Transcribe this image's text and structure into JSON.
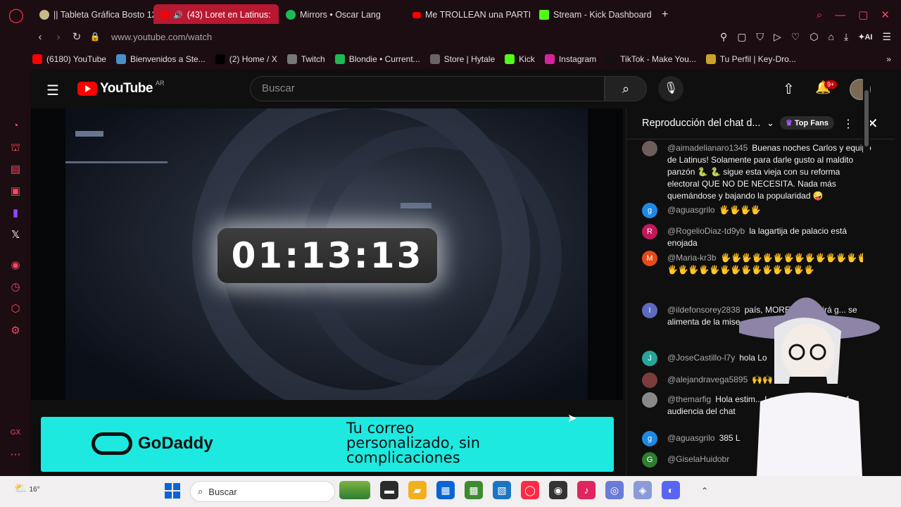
{
  "tabs": [
    {
      "label": "|| Tableta Gráfica Bosto 12",
      "icon": "bosto-icon",
      "active": false
    },
    {
      "label": "(43) Loret en Latinus:",
      "icon": "youtube-icon",
      "active": true
    },
    {
      "label": "Mirrors • Oscar Lang",
      "icon": "spotify-icon",
      "active": false
    },
    {
      "label": "Me TROLLEAN una PARTI",
      "icon": "youtube-icon",
      "active": false
    },
    {
      "label": "Stream - Kick Dashboard",
      "icon": "kick-icon",
      "active": false
    }
  ],
  "address": {
    "url": "www.youtube.com/watch",
    "ai_label": "AI"
  },
  "bookmarks": [
    {
      "label": "(6180) YouTube",
      "icon": "youtube-icon",
      "color": "#ff0000"
    },
    {
      "label": "Bienvenidos a Ste...",
      "icon": "steam-icon",
      "color": "#4a90c8"
    },
    {
      "label": "(2) Home / X",
      "icon": "x-icon",
      "color": "#000000"
    },
    {
      "label": "Twitch",
      "icon": "page-icon",
      "color": "#777777"
    },
    {
      "label": "Blondie • Current...",
      "icon": "spotify-icon",
      "color": "#1db954"
    },
    {
      "label": "Store | Hytale",
      "icon": "hytale-icon",
      "color": "#666666"
    },
    {
      "label": "Kick",
      "icon": "kick-icon",
      "color": "#53fc18"
    },
    {
      "label": "Instagram",
      "icon": "instagram-icon",
      "color": "#d6249f"
    },
    {
      "label": "TikTok - Make You...",
      "icon": "tiktok-icon",
      "color": "#111111"
    },
    {
      "label": "Tu Perfil | Key-Dro...",
      "icon": "keydrop-icon",
      "color": "#c9a227"
    }
  ],
  "youtube": {
    "logo_text": "YouTube",
    "region": "AR",
    "search_placeholder": "Buscar",
    "notification_count": "9+"
  },
  "player": {
    "countdown": "01:13:13"
  },
  "ad": {
    "brand": "GoDaddy",
    "text_lines": [
      "Tu correo",
      "personalizado, sin",
      "complicaciones"
    ]
  },
  "chat": {
    "title": "Reproducción del chat d...",
    "filter": "Top Fans",
    "messages": [
      {
        "initial": "",
        "avatar_color": "#6d5d5d",
        "user": "@aimadelianaro1345",
        "text": "Buenas noches Carlos y equipo de Latinus! Solamente para darle gusto al maldito panzón 🐍 🐍 sigue esta vieja con su reforma electoral QUE NO DE NECESITA. Nada más quemándose y bajando la popularidad 🤪"
      },
      {
        "initial": "g",
        "avatar_color": "#1e88e5",
        "user": "@aguasgrilo",
        "text": "🖐🖐🖐🖐"
      },
      {
        "initial": "R",
        "avatar_color": "#c2185b",
        "user": "@RogelioDiaz-td9yb",
        "text": "la lagartija de palacio está enojada"
      },
      {
        "initial": "M",
        "avatar_color": "#e64a19",
        "user": "@Maria-kr3b",
        "text": "🖐🖐🖐🖐🖐🖐🖐🖐🖐🖐🖐🖐🖐🖐🖐🖐🖐🖐🖐🖐🖐🖐🖐🖐🖐🖐🖐🖐"
      },
      {
        "initial": "I",
        "avatar_color": "#5c6bc0",
        "user": "@ildefonsorey2838",
        "text": "país, MORENA seguirá g... se alimenta de la mise... oportunidades."
      },
      {
        "initial": "J",
        "avatar_color": "#26a69a",
        "user": "@JoseCastillo-l7y",
        "text": "hola Lo"
      },
      {
        "initial": "",
        "avatar_color": "#7b3b3b",
        "user": "@alejandravega5895",
        "text": "🙌🙌"
      },
      {
        "initial": "",
        "avatar_color": "#888888",
        "user": "@themarfig",
        "text": "Hola estim... Loret pero igual con af... audiencia del chat"
      },
      {
        "initial": "g",
        "avatar_color": "#1e88e5",
        "user": "@aguasgrilo",
        "text": "385 L"
      },
      {
        "initial": "G",
        "avatar_color": "#2e7d32",
        "user": "@GiselaHuidobr",
        "text": ""
      }
    ]
  },
  "taskbar": {
    "weather": "16°",
    "search_placeholder": "Buscar",
    "apps": [
      {
        "icon": "files-icon",
        "color": "#2b2b2b"
      },
      {
        "icon": "folder-icon",
        "color": "#f2b01e"
      },
      {
        "icon": "store-icon",
        "color": "#0a64d6"
      },
      {
        "icon": "minecraft-icon",
        "color": "#3f8a2f"
      },
      {
        "icon": "photos-icon",
        "color": "#1a76c4"
      },
      {
        "icon": "opera-gx-icon",
        "color": "#ff2a45"
      },
      {
        "icon": "obs-icon",
        "color": "#333333"
      },
      {
        "icon": "tiktok-icon",
        "color": "#e0245e"
      },
      {
        "icon": "vtuber-app-icon",
        "color": "#6a7bd8"
      },
      {
        "icon": "app-icon",
        "color": "#8a9bd8"
      },
      {
        "icon": "discord-icon",
        "color": "#5865f2"
      }
    ]
  }
}
